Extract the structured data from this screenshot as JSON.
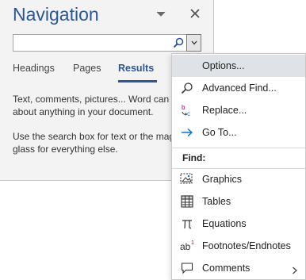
{
  "nav": {
    "title": "Navigation",
    "search": {
      "value": "",
      "placeholder": ""
    },
    "tabs": [
      {
        "label": "Headings",
        "active": false
      },
      {
        "label": "Pages",
        "active": false
      },
      {
        "label": "Results",
        "active": true
      }
    ],
    "results_text_1": "Text, comments, pictures... Word can find just about anything in your document.",
    "results_text_2": "Use the search box for text or the magnifying glass for everything else.",
    "icons": {
      "pin": "chevron-down-icon",
      "close": "close-icon",
      "search": "search-icon",
      "dropdown": "dropdown-arrow-icon"
    }
  },
  "menu": {
    "items": [
      {
        "label": "Options...",
        "icon": "",
        "highlighted": true
      },
      {
        "label": "Advanced Find...",
        "icon": "search-icon"
      },
      {
        "label": "Replace...",
        "icon": "replace-icon"
      },
      {
        "label": "Go To...",
        "icon": "arrow-right-icon"
      }
    ],
    "find_section_label": "Find:",
    "find_items": [
      {
        "label": "Graphics",
        "icon": "graphics-icon"
      },
      {
        "label": "Tables",
        "icon": "table-icon"
      },
      {
        "label": "Equations",
        "icon": "pi-icon"
      },
      {
        "label": "Footnotes/Endnotes",
        "icon": "footnote-icon"
      },
      {
        "label": "Comments",
        "icon": "comment-icon",
        "has_submenu": true
      }
    ]
  },
  "colors": {
    "accent": "#2b579a",
    "pane_bg": "#f3f3f3",
    "menu_highlight": "#dfe3e8",
    "icon_blue": "#0078d4"
  }
}
